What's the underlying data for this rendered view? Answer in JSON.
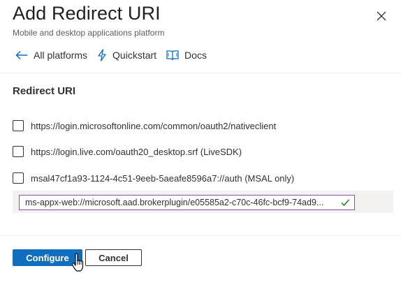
{
  "dialog": {
    "title": "Add Redirect URI",
    "subtitle": "Mobile and desktop applications platform",
    "close_icon": "close-icon"
  },
  "nav": {
    "items": [
      {
        "label": "All platforms",
        "icon": "back-arrow-icon"
      },
      {
        "label": "Quickstart",
        "icon": "lightning-icon"
      },
      {
        "label": "Docs",
        "icon": "book-icon"
      }
    ]
  },
  "redirect": {
    "section_title": "Redirect URI",
    "options": [
      {
        "label": "https://login.microsoftonline.com/common/oauth2/nativeclient",
        "checked": false
      },
      {
        "label": "https://login.live.com/oauth20_desktop.srf (LiveSDK)",
        "checked": false
      },
      {
        "label": "msal47cf1a93-1124-4c51-9eeb-5aeafe8596a7://auth (MSAL only)",
        "checked": false
      }
    ],
    "custom_uri_value": "ms-appx-web://microsoft.aad.brokerplugin/e05585a2-c70c-46fc-bcf9-74ad9...",
    "valid_icon": "checkmark-icon"
  },
  "footer": {
    "configure_label": "Configure",
    "cancel_label": "Cancel"
  },
  "colors": {
    "primary": "#106ebe",
    "input_border": "#8a4fb3",
    "valid": "#107c10"
  }
}
